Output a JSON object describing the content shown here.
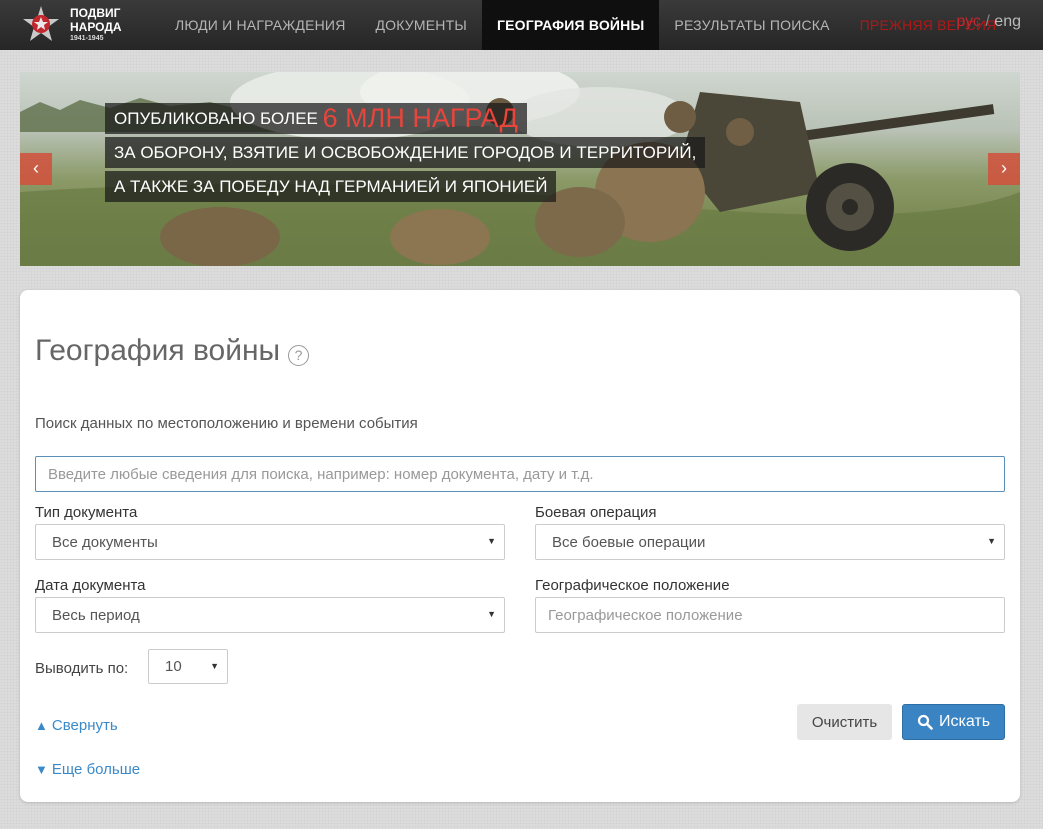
{
  "nav": {
    "logo": {
      "line1": "ПОДВИГ",
      "line2": "НАРОДА",
      "years": "1941-1945"
    },
    "items": [
      {
        "label": "ЛЮДИ И НАГРАЖДЕНИЯ"
      },
      {
        "label": "ДОКУМЕНТЫ"
      },
      {
        "label": "ГЕОГРАФИЯ ВОЙНЫ",
        "active": true
      },
      {
        "label": "РЕЗУЛЬТАТЫ ПОИСКА"
      },
      {
        "label": "ПРЕЖНЯЯ ВЕРСИЯ"
      }
    ],
    "lang_ru": "рус",
    "lang_sep": "/",
    "lang_en": "eng"
  },
  "banner": {
    "line1_prefix": "ОПУБЛИКОВАНО БОЛЕЕ",
    "line1_highlight": "6 МЛН НАГРАД",
    "line2": "ЗА ОБОРОНУ, ВЗЯТИЕ И ОСВОБОЖДЕНИЕ ГОРОДОВ И ТЕРРИТОРИЙ,",
    "line3": "А ТАКЖЕ ЗА ПОБЕДУ НАД ГЕРМАНИЕЙ И ЯПОНИЕЙ",
    "prev_label": "‹",
    "next_label": "›"
  },
  "panel": {
    "title": "География войны",
    "help": "?",
    "subtitle": "Поиск данных по местоположению и времени события",
    "search_placeholder": "Введите любые сведения для поиска, например: номер документа, дату и т.д.",
    "doc_type_label": "Тип документа",
    "doc_type_value": "Все документы",
    "operation_label": "Боевая операция",
    "operation_value": "Все боевые операции",
    "date_label": "Дата документа",
    "date_value": "Весь период",
    "geo_label": "Географическое положение",
    "geo_placeholder": "Географическое положение",
    "rows_label": "Выводить по:",
    "rows_value": "10",
    "collapse_link": "Свернуть",
    "more_link": "Еще больше",
    "clear_button": "Очистить",
    "search_button": "Искать"
  },
  "colors": {
    "accent_blue": "#3a84c4",
    "link_blue": "#3a89c9",
    "brand_red": "#c0282d",
    "highlight_red": "#e8453c"
  }
}
